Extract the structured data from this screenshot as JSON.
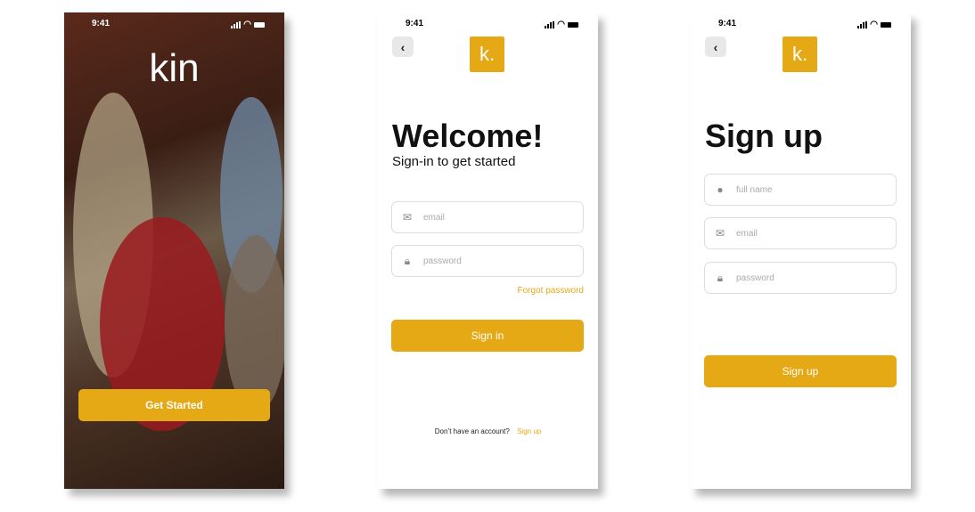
{
  "status": {
    "time": "9:41"
  },
  "splash": {
    "brand": "kin",
    "cta": "Get Started"
  },
  "signin": {
    "logo": "k.",
    "title": "Welcome!",
    "subtitle": "Sign-in to get started",
    "email_placeholder": "email",
    "password_placeholder": "password",
    "forgot": "Forgot password",
    "submit": "Sign in",
    "no_account": "Don’t have an account?",
    "signup_link": "Sign up"
  },
  "signup": {
    "logo": "k.",
    "title": "Sign up",
    "name_placeholder": "full name",
    "email_placeholder": "email",
    "password_placeholder": "password",
    "submit": "Sign up"
  },
  "colors": {
    "accent": "#e6a916"
  }
}
